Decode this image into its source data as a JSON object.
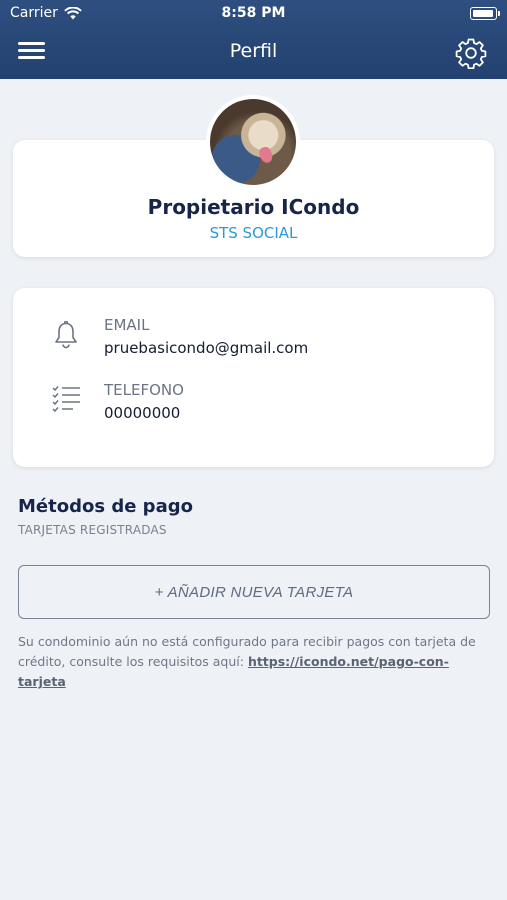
{
  "status_bar": {
    "carrier": "Carrier",
    "time": "8:58 PM"
  },
  "navbar": {
    "title": "Perfil",
    "left_icon": "menu-icon",
    "right_icon": "gear-icon"
  },
  "profile": {
    "name": "Propietario ICondo",
    "subtitle": "STS SOCIAL"
  },
  "contact": {
    "email_label": "EMAIL",
    "email_value": "pruebasicondo@gmail.com",
    "email_icon": "bell-icon",
    "phone_label": "TELEFONO",
    "phone_value": "00000000",
    "phone_icon": "checklist-icon"
  },
  "payment": {
    "title": "Métodos de pago",
    "subtitle": "TARJETAS REGISTRADAS",
    "add_button_label": "+ AÑADIR NUEVA TARJETA",
    "note_text": "Su condominio aún no está configurado para recibir pagos con tarjeta de crédito, consulte los requisitos aquí: ",
    "note_link": "https://icondo.net/pago-con-tarjeta"
  },
  "colors": {
    "header": "#2a4a7a",
    "accent": "#2a9ad6",
    "background": "#eef1f6"
  }
}
